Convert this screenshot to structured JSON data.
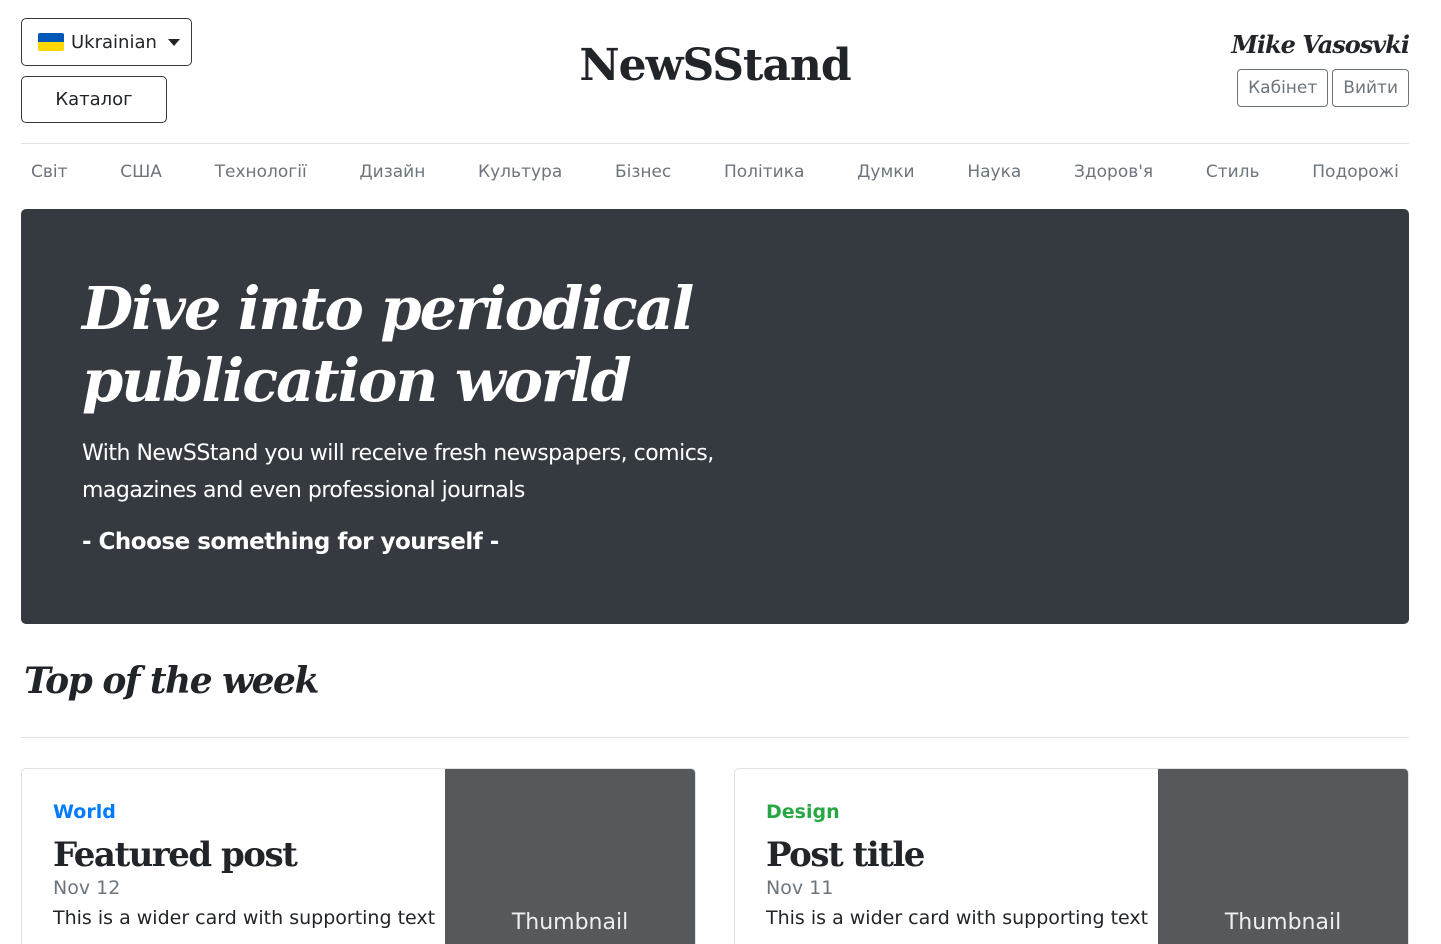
{
  "header": {
    "language_label": "Ukrainian",
    "catalog_label": "Каталог",
    "brand": "NewSStand",
    "user_name": "Mike Vasosvki",
    "cabinet_label": "Кабінет",
    "logout_label": "Вийти"
  },
  "nav": {
    "items": [
      {
        "label": "Світ"
      },
      {
        "label": "США"
      },
      {
        "label": "Технології"
      },
      {
        "label": "Дизайн"
      },
      {
        "label": "Культура"
      },
      {
        "label": "Бізнес"
      },
      {
        "label": "Політика"
      },
      {
        "label": "Думки"
      },
      {
        "label": "Наука"
      },
      {
        "label": "Здоров'я"
      },
      {
        "label": "Стиль"
      },
      {
        "label": "Подорожі"
      }
    ]
  },
  "hero": {
    "title_line1": "Dive into periodical",
    "title_line2": "publication world",
    "lead_line1": "With NewSStand you will receive fresh newspapers, comics,",
    "lead_line2": "magazines and even professional journals",
    "cta": "- Choose something for yourself -"
  },
  "section": {
    "title": "Top of the week"
  },
  "cards": [
    {
      "category": "World",
      "category_color": "#007bff",
      "title": "Featured post",
      "date": "Nov 12",
      "text": "This is a wider card with supporting text",
      "thumbnail_label": "Thumbnail"
    },
    {
      "category": "Design",
      "category_color": "#28a745",
      "title": "Post title",
      "date": "Nov 11",
      "text": "This is a wider card with supporting text",
      "thumbnail_label": "Thumbnail"
    }
  ],
  "colors": {
    "hero_bg": "#343a40",
    "thumb_bg": "#55595c",
    "muted": "#6c757d",
    "flag_blue": "#0057b7",
    "flag_yellow": "#ffd700"
  }
}
